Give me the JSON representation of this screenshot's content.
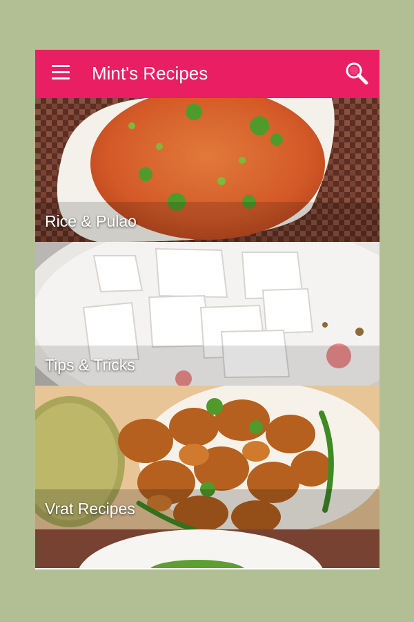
{
  "app": {
    "title": "Mint's Recipes",
    "bar_color": "#e91e63",
    "menu_icon": "hamburger-menu-icon",
    "search_icon": "search-icon"
  },
  "categories": [
    {
      "label": "Rice & Pulao",
      "image": "tomato-rice-pulao-bowl"
    },
    {
      "label": "Tips & Tricks",
      "image": "paneer-cubes-plate"
    },
    {
      "label": "Vrat Recipes",
      "image": "fried-pakoda-bowl"
    },
    {
      "label": "",
      "image": "green-chutney-bowl"
    }
  ]
}
